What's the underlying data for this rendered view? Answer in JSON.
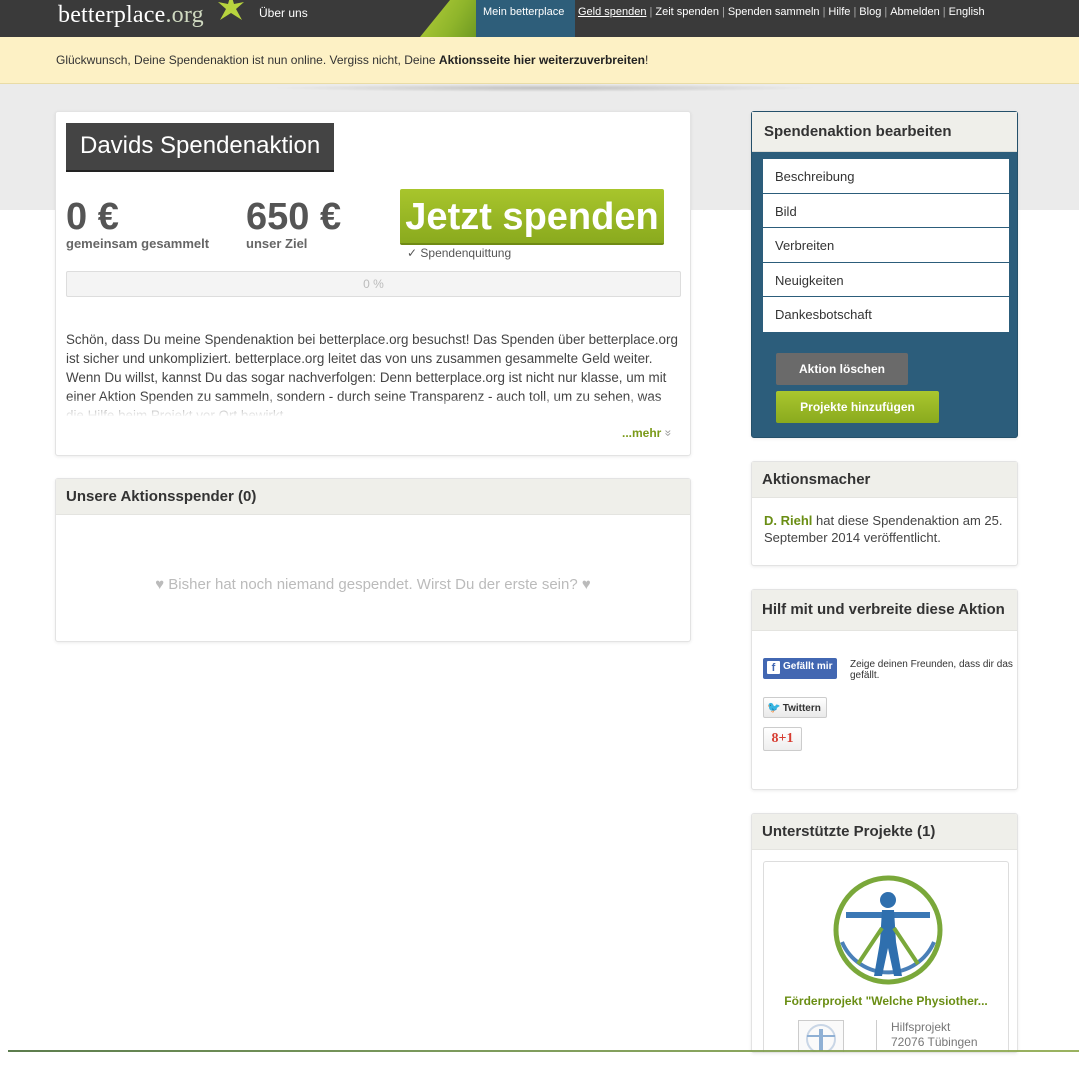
{
  "nav": {
    "logo_main": "betterplace",
    "logo_org": ".org",
    "about": "Über uns",
    "mine": "Mein betterplace",
    "links": [
      "Geld spenden",
      "Zeit spenden",
      "Spenden sammeln",
      "Hilfe",
      "Blog",
      "Abmelden",
      "English"
    ]
  },
  "notice": {
    "text_start": "Glückwunsch, Deine Spendenaktion ist nun online. Vergiss nicht, Deine ",
    "text_bold": "Aktionsseite hier weiterzuverbreiten",
    "text_end": "!"
  },
  "campaign": {
    "title": "Davids Spendenaktion",
    "collected_amount": "0 €",
    "collected_label": "gemeinsam gesammelt",
    "goal_amount": "650 €",
    "goal_label": "unser Ziel",
    "donate_label": "Jetzt spenden",
    "receipt_label": "✓ Spendenquittung",
    "progress_percent": 0,
    "progress_text": "0 %",
    "description": "Schön, dass Du meine Spendenaktion bei betterplace.org besuchst! Das Spenden über betterplace.org ist sicher und unkompliziert. betterplace.org leitet das von uns zusammen gesammelte Geld weiter. Wenn Du willst, kannst Du das sogar nachverfolgen: Denn betterplace.org ist nicht nur klasse, um mit einer Aktion Spenden zu sammeln, sondern - durch seine Transparenz - auch toll, um zu sehen, was die Hilfe beim Projekt vor Ort bewirkt.",
    "more_label": "...mehr",
    "more_icon": "»"
  },
  "donors": {
    "title": "Unsere Aktionsspender (0)",
    "empty_text": "♥ Bisher hat noch niemand gespendet. Wirst Du der erste sein? ♥"
  },
  "edit": {
    "title": "Spendenaktion bearbeiten",
    "items": [
      "Beschreibung",
      "Bild",
      "Verbreiten",
      "Neuigkeiten",
      "Dankesbotschaft"
    ],
    "delete_label": "Aktion löschen",
    "add_label": "Projekte hinzufügen"
  },
  "maker": {
    "title": "Aktionsmacher",
    "name": "D. Riehl",
    "text": " hat diese Spendenaktion am 25. September 2014 veröffentlicht."
  },
  "share": {
    "title": "Hilf mit und verbreite diese Aktion",
    "fb_label": "Gefällt mir",
    "fb_text": "Zeige deinen Freunden, dass dir das gefällt.",
    "tw_label": "Twittern",
    "gp_label": "8+1"
  },
  "projects": {
    "title": "Unterstützte Projekte (1)",
    "name": "Förderprojekt \"Welche Physiother...",
    "type": "Hilfsprojekt",
    "location": "72076 Tübingen"
  },
  "colors": {
    "accent_green": "#a8c52c",
    "nav_dark": "#3a3a3a",
    "edit_blue": "#2c5d7b",
    "notice_bg": "#fdf1c5"
  }
}
